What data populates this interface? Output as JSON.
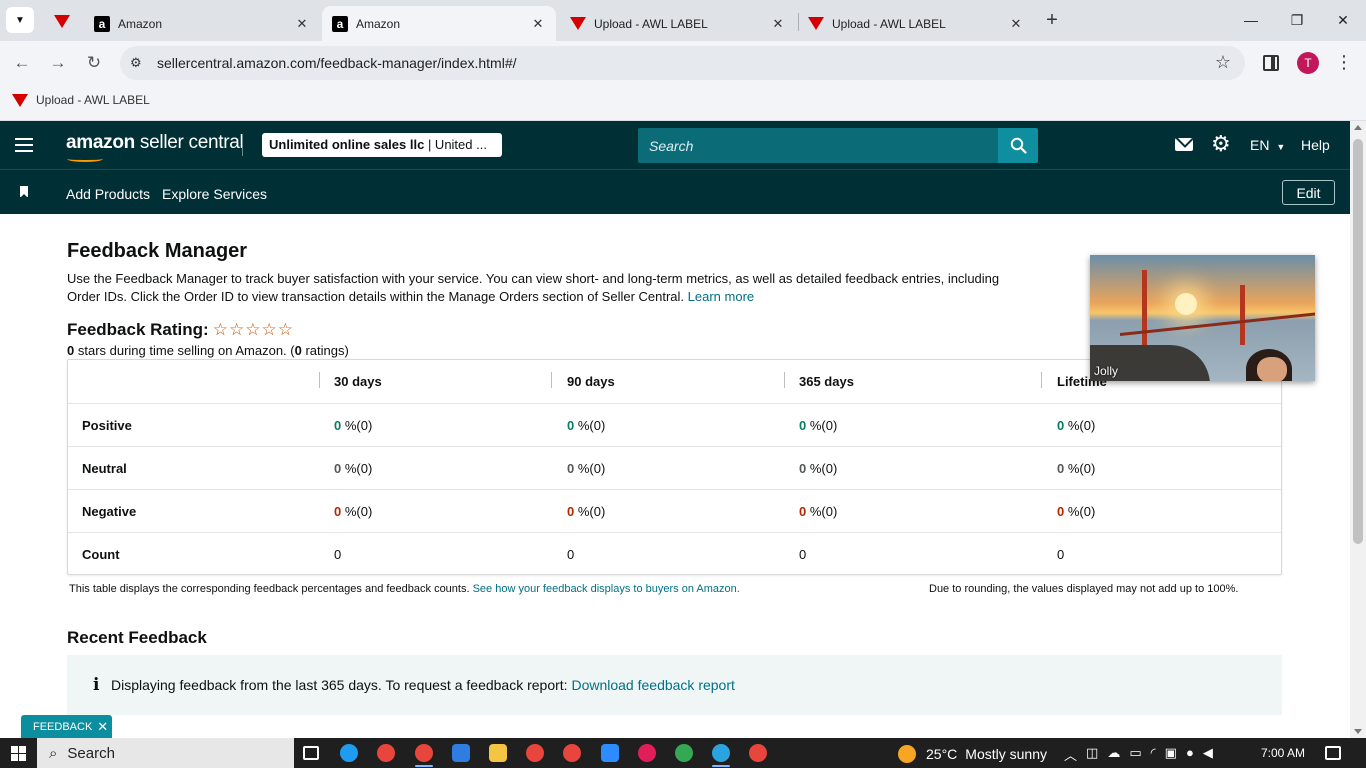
{
  "browser": {
    "tabs": [
      {
        "title": "Amazon",
        "favicon": "amazon-favicon",
        "active": false
      },
      {
        "title": "Amazon",
        "favicon": "amazon-favicon",
        "active": true
      },
      {
        "title": "Upload - AWL LABEL",
        "favicon": "awl-favicon",
        "active": false
      },
      {
        "title": "Upload - AWL LABEL",
        "favicon": "awl-favicon",
        "active": false
      }
    ],
    "close_glyph": "✕",
    "new_tab_glyph": "+",
    "url": "sellercentral.amazon.com/feedback-manager/index.html#/",
    "profile_initial": "T",
    "bookmark": "Upload - AWL LABEL"
  },
  "header": {
    "logo_bold": "amazon",
    "logo_rest": " seller central",
    "account_bold": "Unlimited online sales llc",
    "account_rest": " | United ...",
    "search_placeholder": "Search",
    "lang": "EN",
    "help": "Help"
  },
  "subnav": {
    "links": [
      "Add Products",
      "Explore Services"
    ],
    "edit": "Edit"
  },
  "page": {
    "title": "Feedback Manager",
    "intro_line1": "Use the Feedback Manager to track buyer satisfaction with your service. You can view short- and long-term metrics, as well as detailed feedback entries, including",
    "intro_line2": "Order IDs. Click the Order ID to view transaction details within the Manage Orders section of Seller Central.",
    "learn_more": "Learn more",
    "rating_label": "Feedback Rating:",
    "rating_stars": 0,
    "rating_stars_max": 5,
    "rating_sub_value": "0",
    "rating_sub_mid": " stars during time selling on Amazon. (",
    "rating_sub_count": "0",
    "rating_sub_end": " ratings)"
  },
  "feedback_table": {
    "columns": [
      "30 days",
      "90 days",
      "365 days",
      "Lifetime"
    ],
    "rows": [
      {
        "label": "Positive",
        "kind": "pos",
        "values": [
          [
            "0",
            " %(0)"
          ],
          [
            "0",
            " %(0)"
          ],
          [
            "0",
            " %(0)"
          ],
          [
            "0",
            " %(0)"
          ]
        ]
      },
      {
        "label": "Neutral",
        "kind": "neu",
        "values": [
          [
            "0",
            " %(0)"
          ],
          [
            "0",
            " %(0)"
          ],
          [
            "0",
            " %(0)"
          ],
          [
            "0",
            " %(0)"
          ]
        ]
      },
      {
        "label": "Negative",
        "kind": "neg",
        "values": [
          [
            "0",
            " %(0)"
          ],
          [
            "0",
            " %(0)"
          ],
          [
            "0",
            " %(0)"
          ],
          [
            "0",
            " %(0)"
          ]
        ]
      },
      {
        "label": "Count",
        "kind": "count",
        "values": [
          [
            "",
            "0"
          ],
          [
            "",
            "0"
          ],
          [
            "",
            "0"
          ],
          [
            "",
            "0"
          ]
        ]
      }
    ],
    "note_text": "This table displays the corresponding feedback percentages and feedback counts. ",
    "note_link": "See how your feedback displays to buyers on Amazon.",
    "note_right": "Due to rounding, the values displayed may not add up to 100%."
  },
  "recent": {
    "title": "Recent Feedback",
    "info_icon": "i",
    "info_text": "Displaying feedback from the last 365 days. To request a feedback report: ",
    "info_link": "Download feedback report"
  },
  "feedback_tab": {
    "label": "FEEDBACK",
    "close": "✕"
  },
  "video": {
    "participant": "Jolly"
  },
  "taskbar": {
    "search": "Search",
    "temperature": "25°C",
    "weather": "Mostly sunny",
    "time": "7:00 AM",
    "icons": [
      {
        "name": "task-view-icon",
        "color": "#ffffff"
      },
      {
        "name": "edge-icon",
        "color": "#1f9cf0"
      },
      {
        "name": "chrome-icon",
        "color": "#e8453c"
      },
      {
        "name": "chrome-icon",
        "color": "#e8453c",
        "active": true
      },
      {
        "name": "store-icon",
        "color": "#2f7de1"
      },
      {
        "name": "file-explorer-icon",
        "color": "#f4c542"
      },
      {
        "name": "chrome-icon",
        "color": "#e8453c"
      },
      {
        "name": "chrome-icon",
        "color": "#e8453c"
      },
      {
        "name": "zoom-icon",
        "color": "#2d8cff"
      },
      {
        "name": "slack-icon",
        "color": "#e01e5a"
      },
      {
        "name": "chrome-icon",
        "color": "#34a853"
      },
      {
        "name": "telegram-icon",
        "color": "#2aa3df",
        "active": true
      },
      {
        "name": "chrome-icon",
        "color": "#e8453c"
      }
    ]
  },
  "colors": {
    "header_bg": "#002f36",
    "link": "#007185",
    "positive": "#067d62",
    "negative": "#b12704",
    "search_btn": "#0f8ea0"
  }
}
